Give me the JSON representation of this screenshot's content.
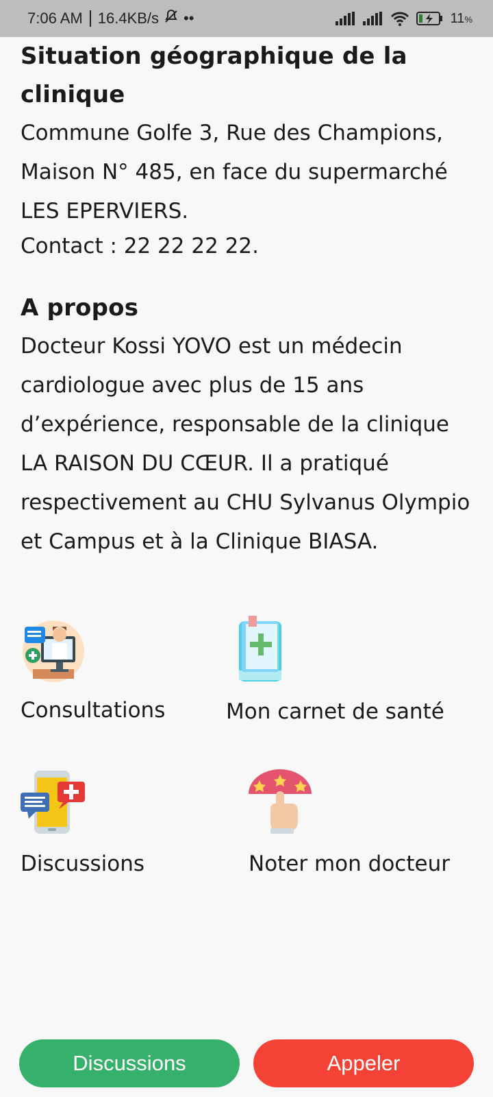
{
  "status_bar": {
    "time": "7:06 AM",
    "speed": "16.4KB/s",
    "battery": "11"
  },
  "location": {
    "title": "Situation géographique de la clinique",
    "text": "Commune Golfe 3, Rue des Champions, Maison N° 485, en face du supermarché LES EPERVIERS.",
    "contact": "Contact : 22 22 22 22."
  },
  "about": {
    "title": "A propos",
    "text": "Docteur Kossi YOVO est un médecin cardiologue avec plus de 15 ans d’expérience, responsable de la clinique LA RAISON DU CŒUR. Il a pratiqué respectivement au CHU Sylvanus Olympio et Campus et à la Clinique BIASA."
  },
  "features": [
    {
      "label": "Consultations",
      "icon": "doctor-consultation-icon"
    },
    {
      "label": "Mon carnet de santé",
      "icon": "health-book-icon"
    },
    {
      "label": "Discussions",
      "icon": "chat-phone-icon"
    },
    {
      "label": "Noter mon docteur",
      "icon": "rating-hand-icon"
    }
  ],
  "buttons": {
    "discussions": "Discussions",
    "call": "Appeler"
  },
  "colors": {
    "green": "#36b16b",
    "red": "#f44336",
    "status_bar": "#bdbdbd"
  }
}
